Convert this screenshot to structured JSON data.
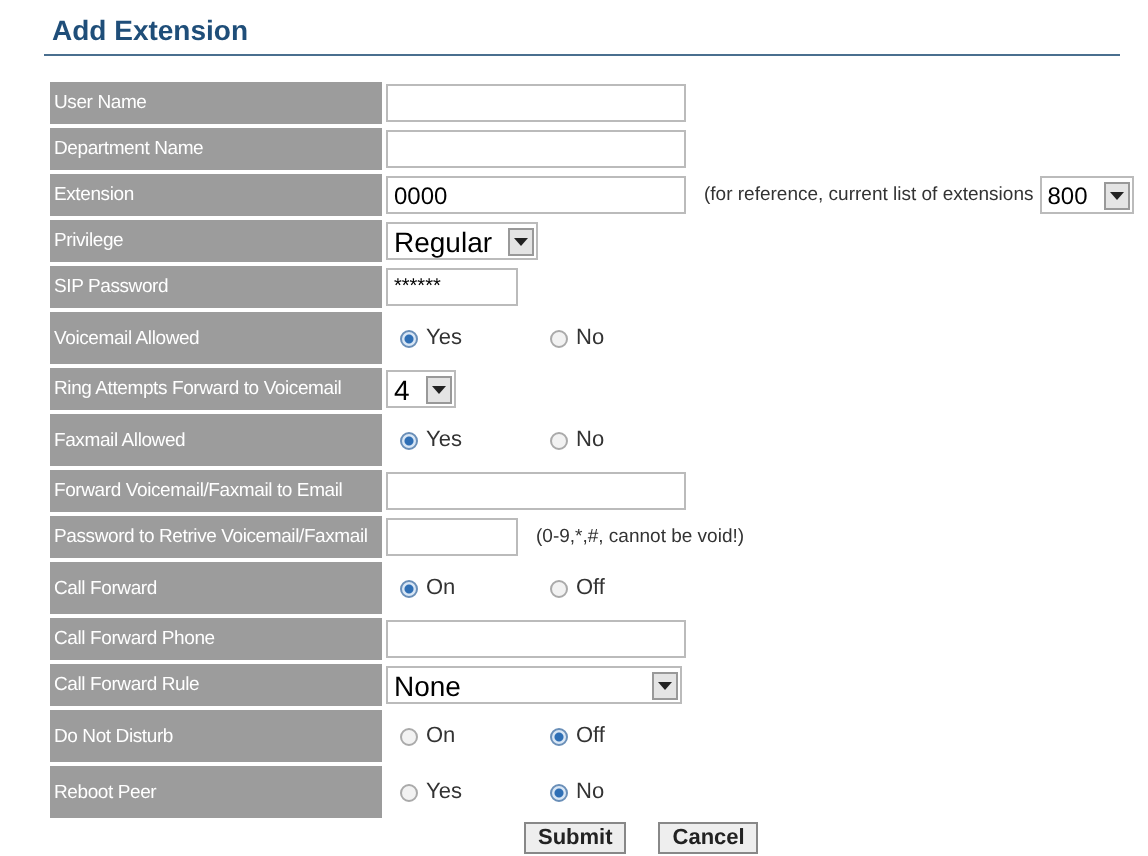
{
  "page": {
    "title": "Add Extension"
  },
  "rows": [
    {
      "label": "User Name",
      "kind": "text"
    },
    {
      "label": "Department Name",
      "kind": "text"
    },
    {
      "label": "Extension",
      "kind": "text",
      "value": "0000",
      "hint": "(for reference, current list of extensions",
      "reference": "800"
    },
    {
      "label": "Privilege",
      "kind": "select",
      "value": "Regular"
    },
    {
      "label": "SIP Password",
      "kind": "short_text",
      "value": "******"
    },
    {
      "label": "Voicemail Allowed",
      "kind": "radio",
      "options": [
        {
          "label": "Yes",
          "selected": true
        },
        {
          "label": "No",
          "selected": false
        }
      ]
    },
    {
      "label": "Ring Attempts Forward to Voicemail",
      "kind": "select",
      "value": "4"
    },
    {
      "label": "Faxmail Allowed",
      "kind": "radio",
      "options": [
        {
          "label": "Yes",
          "selected": true
        },
        {
          "label": "No",
          "selected": false
        }
      ]
    },
    {
      "label": "Forward Voicemail/Faxmail to Email",
      "kind": "text"
    },
    {
      "label": "Password to Retrive Voicemail/Faxmail",
      "kind": "short_text",
      "hint": "(0-9,*,#, cannot be void!)"
    },
    {
      "label": "Call Forward",
      "kind": "radio",
      "options": [
        {
          "label": "On",
          "selected": true
        },
        {
          "label": "Off",
          "selected": false
        }
      ]
    },
    {
      "label": "Call Forward Phone",
      "kind": "text"
    },
    {
      "label": "Call Forward Rule",
      "kind": "wide_select",
      "value": "None"
    },
    {
      "label": "Do Not Disturb",
      "kind": "radio",
      "options": [
        {
          "label": "On",
          "selected": false
        },
        {
          "label": "Off",
          "selected": true
        }
      ]
    },
    {
      "label": "Reboot Peer",
      "kind": "radio",
      "options": [
        {
          "label": "Yes",
          "selected": false
        },
        {
          "label": "No",
          "selected": true
        }
      ]
    }
  ],
  "buttons": [
    "Submit",
    "Cancel"
  ]
}
